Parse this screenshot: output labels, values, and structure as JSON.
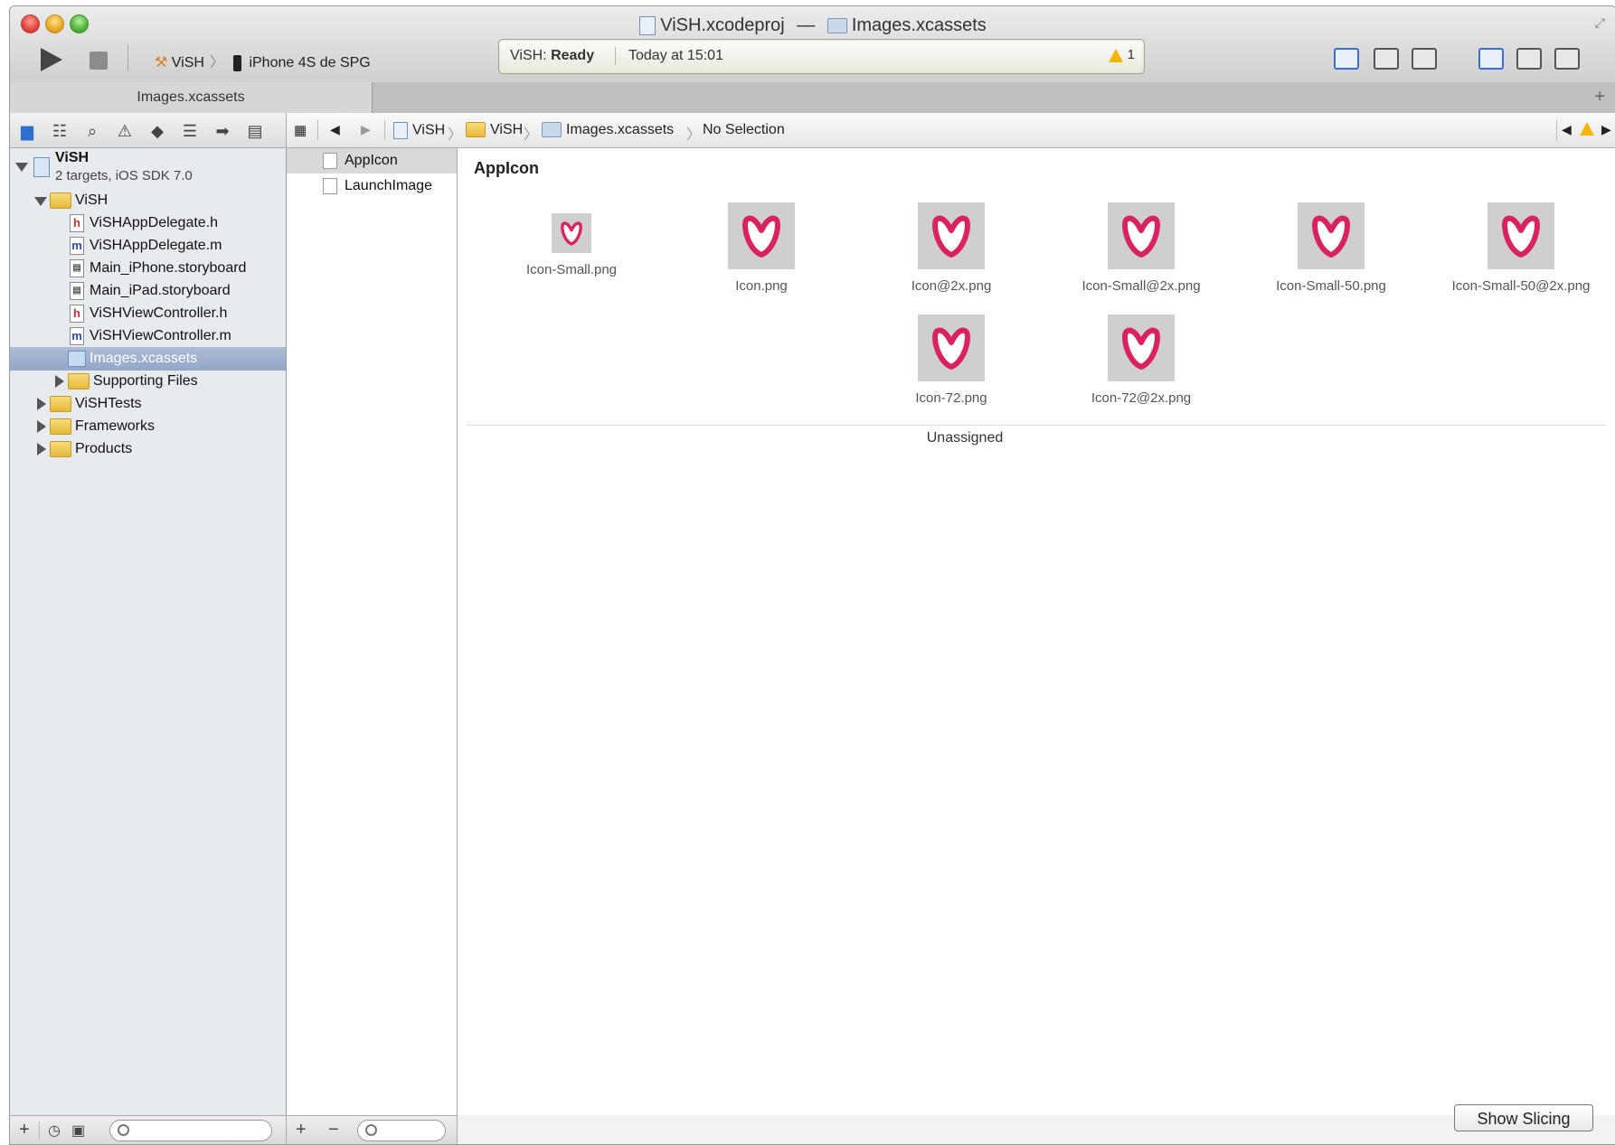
{
  "window": {
    "title_project": "ViSH.xcodeproj",
    "title_separator": "—",
    "title_file": "Images.xcassets"
  },
  "toolbar": {
    "scheme": "ViSH",
    "scheme_separator": "〉",
    "device": "iPhone 4S de SPG",
    "activity_project": "ViSH:",
    "activity_state": "Ready",
    "activity_time": "Today at 15:01",
    "warning_count": "1"
  },
  "tabs": [
    {
      "label": "Images.xcassets"
    }
  ],
  "jumpbar": {
    "items": [
      "ViSH",
      "ViSH",
      "Images.xcassets",
      "No Selection"
    ]
  },
  "navigator": {
    "project_name": "ViSH",
    "project_subtitle": "2 targets, iOS SDK 7.0",
    "group_name": "ViSH",
    "files": [
      {
        "badge": "h",
        "name": "ViSHAppDelegate.h"
      },
      {
        "badge": "m",
        "name": "ViSHAppDelegate.m"
      },
      {
        "badge": "sb",
        "name": "Main_iPhone.storyboard"
      },
      {
        "badge": "sb",
        "name": "Main_iPad.storyboard"
      },
      {
        "badge": "h",
        "name": "ViSHViewController.h"
      },
      {
        "badge": "m",
        "name": "ViSHViewController.m"
      },
      {
        "badge": "xc",
        "name": "Images.xcassets"
      }
    ],
    "subfolders": [
      {
        "name": "Supporting Files"
      }
    ],
    "top_folders": [
      {
        "name": "ViSHTests"
      },
      {
        "name": "Frameworks"
      },
      {
        "name": "Products"
      }
    ]
  },
  "assets": {
    "items": [
      {
        "name": "AppIcon"
      },
      {
        "name": "LaunchImage"
      }
    ]
  },
  "content": {
    "set_title": "AppIcon",
    "icons": [
      {
        "name": "Icon-Small.png"
      },
      {
        "name": "Icon.png"
      },
      {
        "name": "Icon@2x.png"
      },
      {
        "name": "Icon-Small@2x.png"
      },
      {
        "name": "Icon-Small-50.png"
      },
      {
        "name": "Icon-Small-50@2x.png"
      },
      {
        "name": "Icon-72.png"
      },
      {
        "name": "Icon-72@2x.png"
      }
    ],
    "unassigned_label": "Unassigned",
    "show_slicing_label": "Show Slicing"
  },
  "colors": {
    "selection": "#92a6c8",
    "accent": "#3b6fd1",
    "icon_pink": "#d8235f",
    "warning": "#f4b400"
  }
}
